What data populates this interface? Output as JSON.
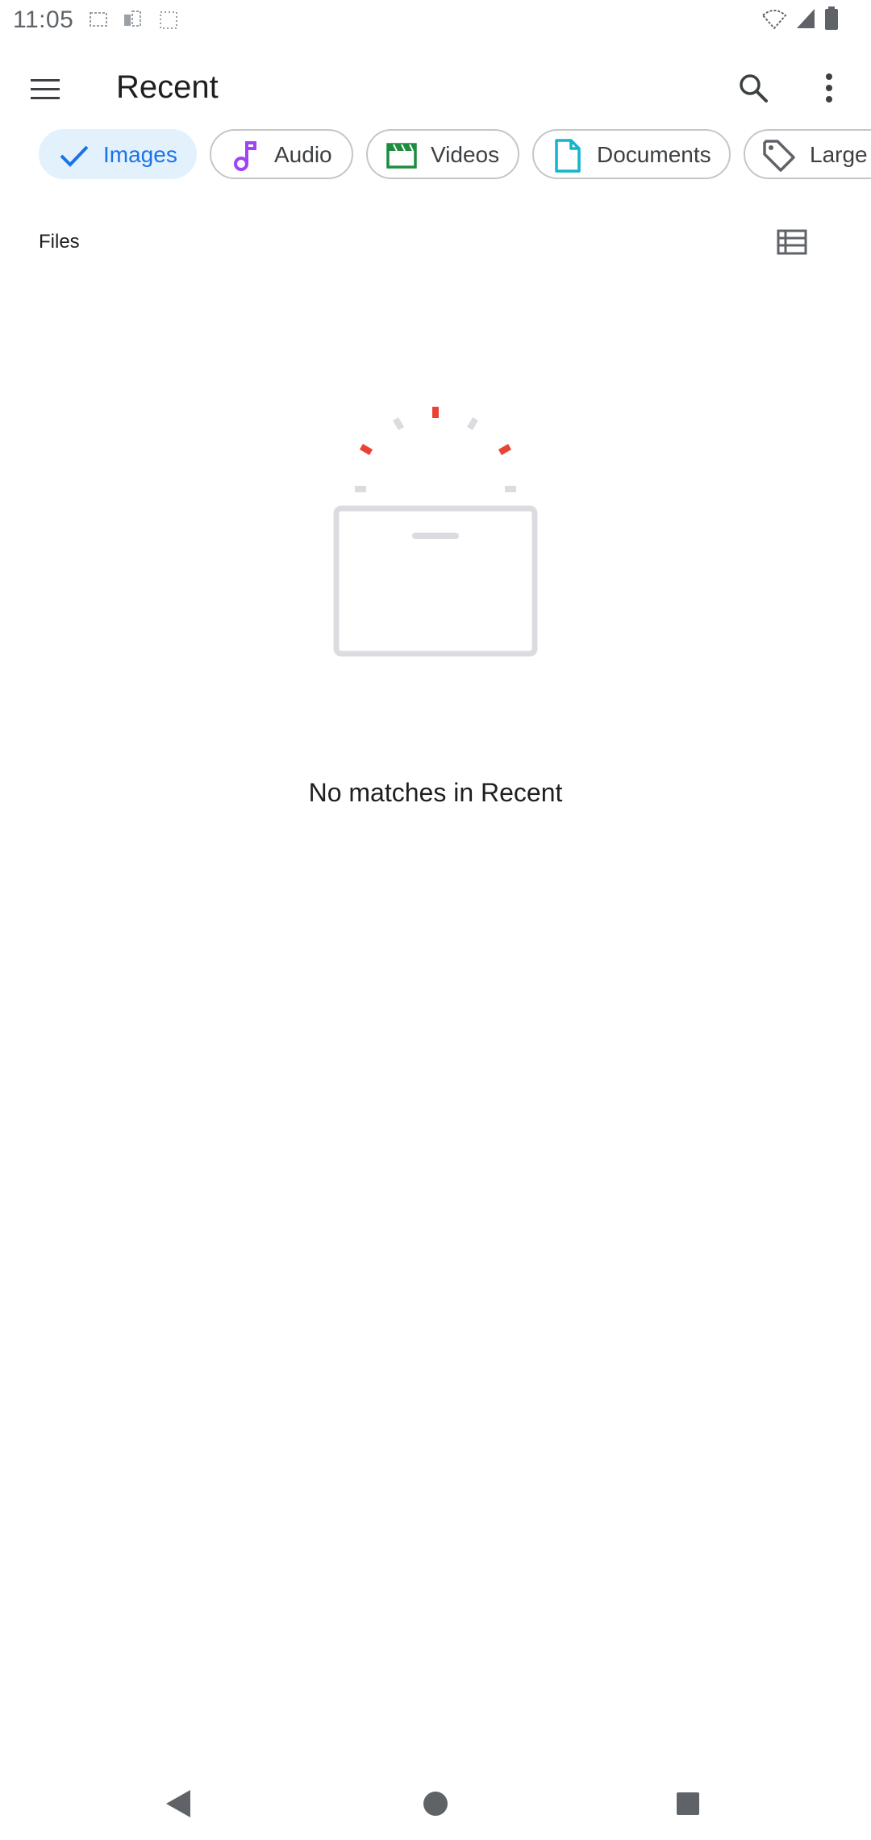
{
  "status_bar": {
    "time": "11:05",
    "notification_icons": [
      "notification-icon-1",
      "notification-icon-2",
      "notification-icon-3"
    ],
    "right_icons": [
      "wifi-icon",
      "signal-icon",
      "battery-icon"
    ]
  },
  "app_bar": {
    "title": "Recent",
    "menu_icon": "hamburger-menu-icon",
    "search_icon": "search-icon",
    "more_icon": "more-vert-icon"
  },
  "filter_chips": [
    {
      "label": "Images",
      "icon": "check-icon",
      "selected": true
    },
    {
      "label": "Audio",
      "icon": "music-note-icon",
      "selected": false
    },
    {
      "label": "Videos",
      "icon": "movie-icon",
      "selected": false
    },
    {
      "label": "Documents",
      "icon": "document-icon",
      "selected": false
    },
    {
      "label": "Large",
      "icon": "tag-icon",
      "selected": false
    }
  ],
  "files_section": {
    "title": "Files",
    "view_toggle_icon": "list-view-icon"
  },
  "empty_state": {
    "message": "No matches in Recent",
    "illustration": "empty-folder-illustration"
  },
  "nav_bar": {
    "back_icon": "back-icon",
    "home_icon": "home-icon",
    "recents_icon": "recents-icon"
  },
  "colors": {
    "accent": "#1a73e8",
    "selected_chip_bg": "#e3f1fd",
    "audio_icon": "#a142f4",
    "videos_icon": "#1e8e3e",
    "documents_icon": "#12b5cb",
    "illustration_red": "#ea4335",
    "illustration_grey": "#dadce0"
  }
}
